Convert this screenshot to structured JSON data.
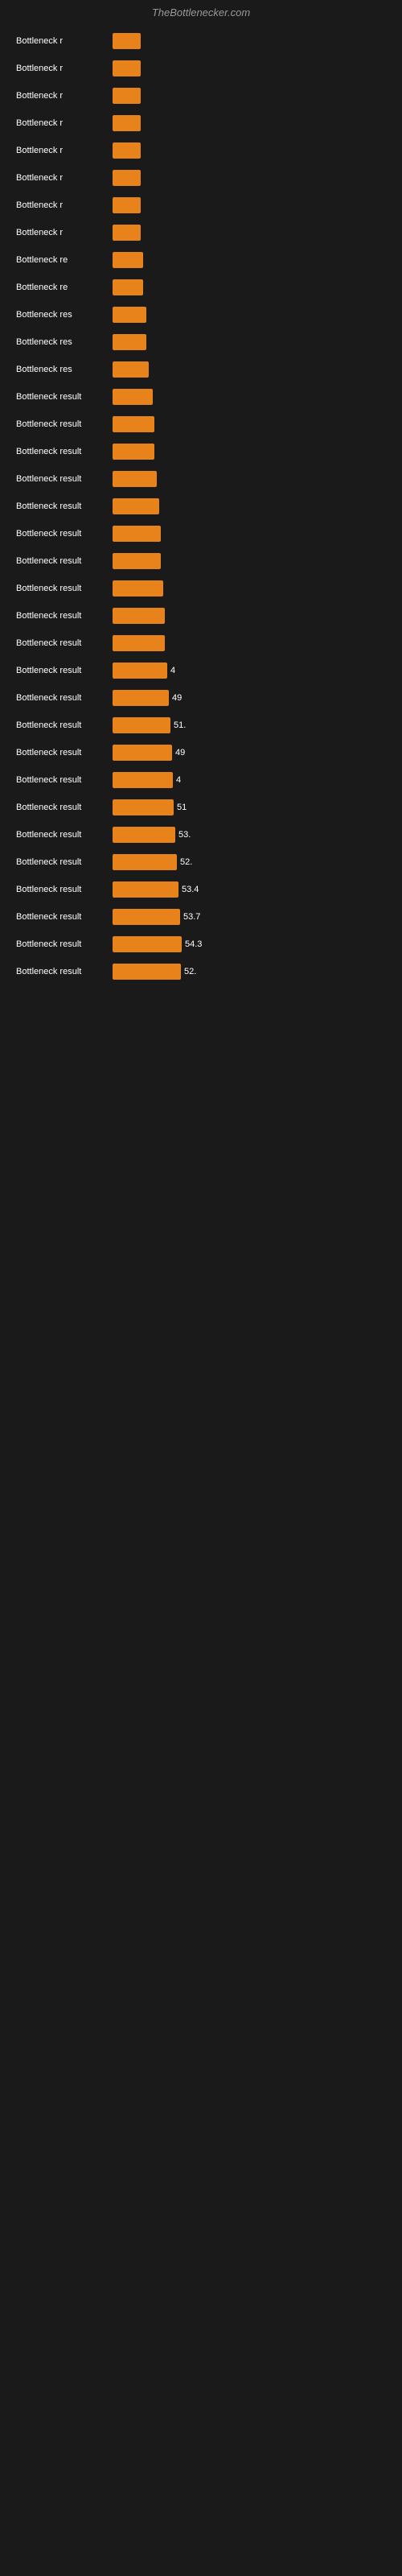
{
  "header": {
    "title": "TheBottlenecker.com"
  },
  "chart": {
    "bars": [
      {
        "label": "Bottleneck r",
        "width": 35,
        "value": ""
      },
      {
        "label": "Bottleneck r",
        "width": 35,
        "value": ""
      },
      {
        "label": "Bottleneck r",
        "width": 35,
        "value": ""
      },
      {
        "label": "Bottleneck r",
        "width": 35,
        "value": ""
      },
      {
        "label": "Bottleneck r",
        "width": 35,
        "value": ""
      },
      {
        "label": "Bottleneck r",
        "width": 35,
        "value": ""
      },
      {
        "label": "Bottleneck r",
        "width": 35,
        "value": ""
      },
      {
        "label": "Bottleneck r",
        "width": 35,
        "value": ""
      },
      {
        "label": "Bottleneck re",
        "width": 38,
        "value": ""
      },
      {
        "label": "Bottleneck re",
        "width": 38,
        "value": ""
      },
      {
        "label": "Bottleneck res",
        "width": 42,
        "value": ""
      },
      {
        "label": "Bottleneck res",
        "width": 42,
        "value": ""
      },
      {
        "label": "Bottleneck res",
        "width": 45,
        "value": ""
      },
      {
        "label": "Bottleneck result",
        "width": 50,
        "value": ""
      },
      {
        "label": "Bottleneck result",
        "width": 52,
        "value": ""
      },
      {
        "label": "Bottleneck result",
        "width": 52,
        "value": ""
      },
      {
        "label": "Bottleneck result",
        "width": 55,
        "value": ""
      },
      {
        "label": "Bottleneck result",
        "width": 58,
        "value": ""
      },
      {
        "label": "Bottleneck result",
        "width": 60,
        "value": ""
      },
      {
        "label": "Bottleneck result",
        "width": 60,
        "value": ""
      },
      {
        "label": "Bottleneck result",
        "width": 63,
        "value": ""
      },
      {
        "label": "Bottleneck result",
        "width": 65,
        "value": ""
      },
      {
        "label": "Bottleneck result",
        "width": 65,
        "value": ""
      },
      {
        "label": "Bottleneck result",
        "width": 68,
        "value": "4"
      },
      {
        "label": "Bottleneck result",
        "width": 70,
        "value": "49"
      },
      {
        "label": "Bottleneck result",
        "width": 72,
        "value": "51."
      },
      {
        "label": "Bottleneck result",
        "width": 74,
        "value": "49"
      },
      {
        "label": "Bottleneck result",
        "width": 75,
        "value": "4"
      },
      {
        "label": "Bottleneck result",
        "width": 76,
        "value": "51"
      },
      {
        "label": "Bottleneck result",
        "width": 78,
        "value": "53."
      },
      {
        "label": "Bottleneck result",
        "width": 80,
        "value": "52."
      },
      {
        "label": "Bottleneck result",
        "width": 82,
        "value": "53.4"
      },
      {
        "label": "Bottleneck result",
        "width": 84,
        "value": "53.7"
      },
      {
        "label": "Bottleneck result",
        "width": 86,
        "value": "54.3"
      },
      {
        "label": "Bottleneck result",
        "width": 85,
        "value": "52."
      }
    ]
  }
}
